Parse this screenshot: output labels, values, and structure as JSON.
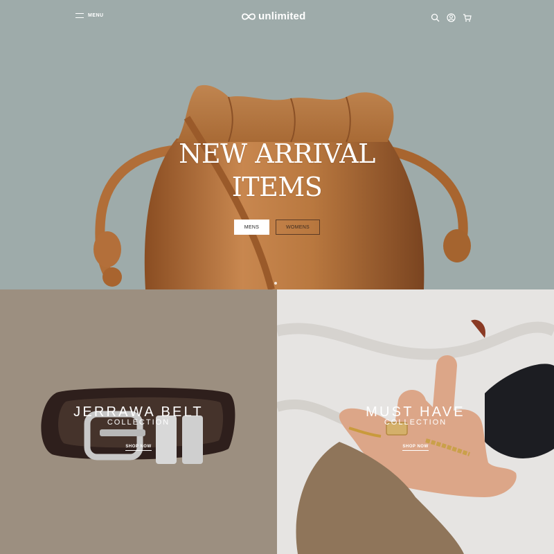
{
  "header": {
    "menu_label": "MENU",
    "logo_text": "unlimited",
    "icons": [
      "search-icon",
      "account-icon",
      "cart-icon"
    ]
  },
  "hero": {
    "title_line1": "NEW ARRIVAL",
    "title_line2": "ITEMS",
    "buttons": [
      {
        "label": "MENS"
      },
      {
        "label": "WOMENS"
      }
    ]
  },
  "collections": [
    {
      "title": "JERRAWA BELT",
      "subtitle": "COLLECTION",
      "link": "SHOP NOW"
    },
    {
      "title": "MUST HAVE",
      "subtitle": "COLLECTION",
      "link": "SHOP NOW"
    }
  ],
  "colors": {
    "hero_bg": "#9eabaa",
    "belt_bg": "#9c8f80",
    "rings_bg": "#e4e2e0",
    "leather": "#b87a45"
  }
}
